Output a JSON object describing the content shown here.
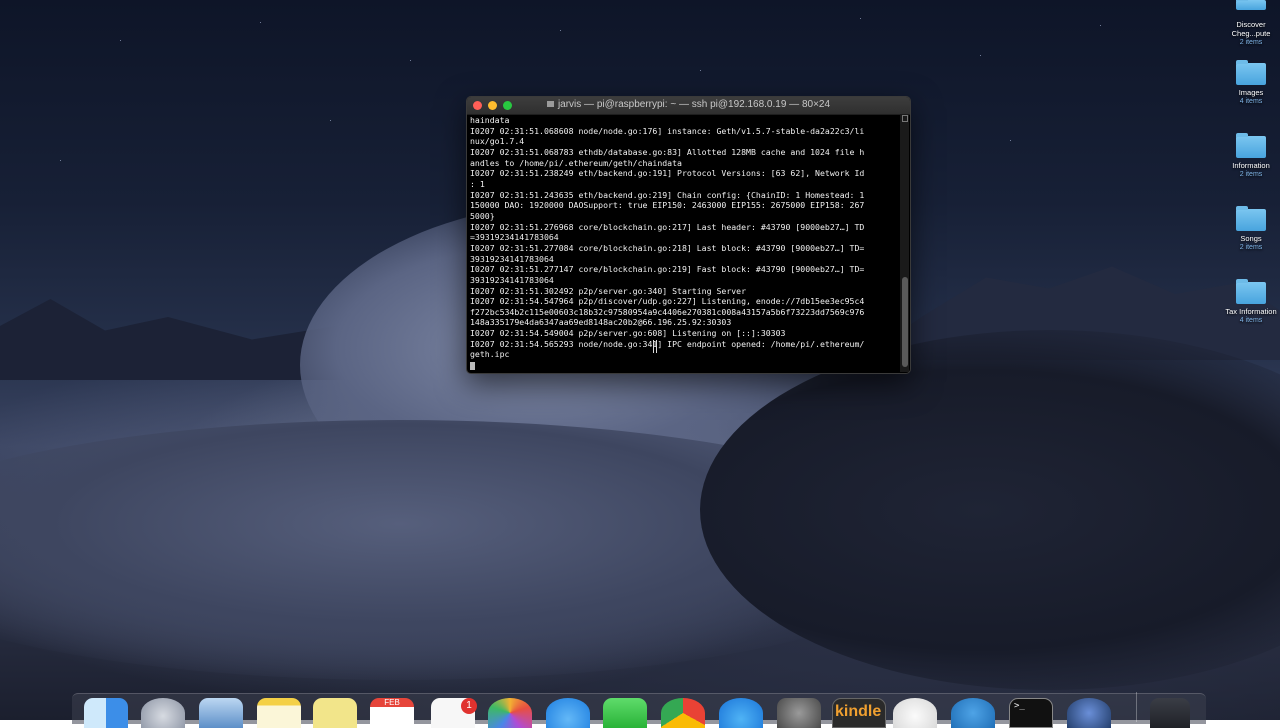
{
  "terminal": {
    "title": "jarvis — pi@raspberrypi: ~ — ssh pi@192.168.0.19 — 80×24",
    "lines": [
      "haindata",
      "I0207 02:31:51.068608 node/node.go:176] instance: Geth/v1.5.7-stable-da2a22c3/li",
      "nux/go1.7.4",
      "I0207 02:31:51.068783 ethdb/database.go:83] Allotted 128MB cache and 1024 file h",
      "andles to /home/pi/.ethereum/geth/chaindata",
      "I0207 02:31:51.238249 eth/backend.go:191] Protocol Versions: [63 62], Network Id",
      ": 1",
      "I0207 02:31:51.243635 eth/backend.go:219] Chain config: {ChainID: 1 Homestead: 1",
      "150000 DAO: 1920000 DAOSupport: true EIP150: 2463000 EIP155: 2675000 EIP158: 267",
      "5000}",
      "I0207 02:31:51.276968 core/blockchain.go:217] Last header: #43790 [9000eb27…] TD",
      "=39319234141783064",
      "I0207 02:31:51.277084 core/blockchain.go:218] Last block: #43790 [9000eb27…] TD=",
      "39319234141783064",
      "I0207 02:31:51.277147 core/blockchain.go:219] Fast block: #43790 [9000eb27…] TD=",
      "39319234141783064",
      "I0207 02:31:51.302492 p2p/server.go:340] Starting Server",
      "I0207 02:31:54.547964 p2p/discover/udp.go:227] Listening, enode://7db15ee3ec95c4",
      "f272bc534b2c115e00603c18b32c97580954a9c4406e270381c008a43157a5b6f73223dd7569c976",
      "148a335179e4da6347aa69ed8148ac20b2@66.196.25.92:30303",
      "I0207 02:31:54.549004 p2p/server.go:608] Listening on [::]:30303",
      "I0207 02:31:54.565293 node/node.go:341] IPC endpoint opened: /home/pi/.ethereum/",
      "geth.ipc"
    ]
  },
  "desktop_icons": [
    {
      "label": "Discover Cheg...pute",
      "sub": "2 items"
    },
    {
      "label": "Images",
      "sub": "4 items"
    },
    {
      "label": "Information",
      "sub": "2 items"
    },
    {
      "label": "Songs",
      "sub": "2 items"
    },
    {
      "label": "Tax Information",
      "sub": "4 items"
    }
  ],
  "dock": {
    "calendar_month": "FEB",
    "reminders_badge": "1",
    "kindle_label": "kindle",
    "terminal_prompt": ">_"
  }
}
